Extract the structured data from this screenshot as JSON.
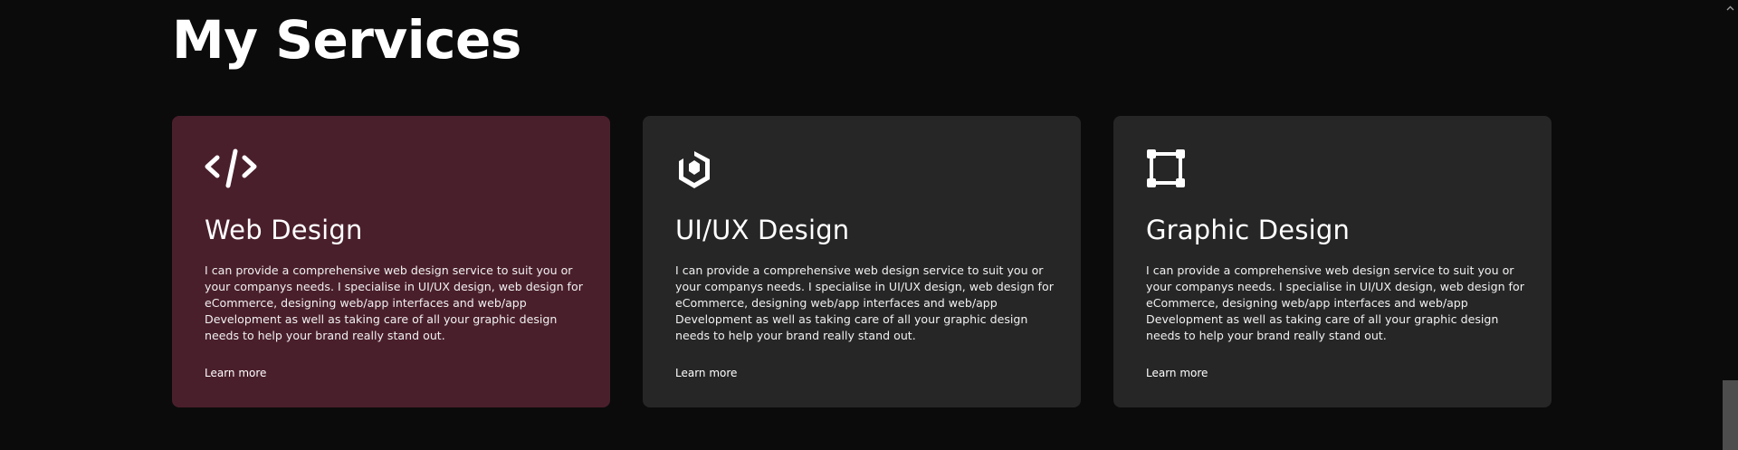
{
  "section": {
    "title": "My Services"
  },
  "cards": [
    {
      "icon": "code-icon",
      "title": "Web Design",
      "description": "I can provide a comprehensive web design service to suit you or your companys needs. I specialise in UI/UX design, web design for eCommerce, designing web/app interfaces and web/app Development as well as taking care of all your graphic design needs to help your brand really stand out.",
      "link": "Learn more",
      "highlighted": true
    },
    {
      "icon": "uiux-cube-icon",
      "title": "UI/UX Design",
      "description": "I can provide a comprehensive web design service to suit you or your companys needs. I specialise in UI/UX design, web design for eCommerce, designing web/app interfaces and web/app Development as well as taking care of all your graphic design needs to help your brand really stand out.",
      "link": "Learn more",
      "highlighted": false
    },
    {
      "icon": "vector-square-icon",
      "title": "Graphic Design",
      "description": "I can provide a comprehensive web design service to suit you or your companys needs. I specialise in UI/UX design, web design for eCommerce, designing web/app interfaces and web/app Development as well as taking care of all your graphic design needs to help your brand really stand out.",
      "link": "Learn more",
      "highlighted": false
    }
  ],
  "colors": {
    "background": "#0b0b0b",
    "card": "#262626",
    "card_highlight": "#4a1f2c",
    "text": "#ffffff"
  },
  "scrollbar": {
    "up_icon": "chevron-up-icon"
  }
}
